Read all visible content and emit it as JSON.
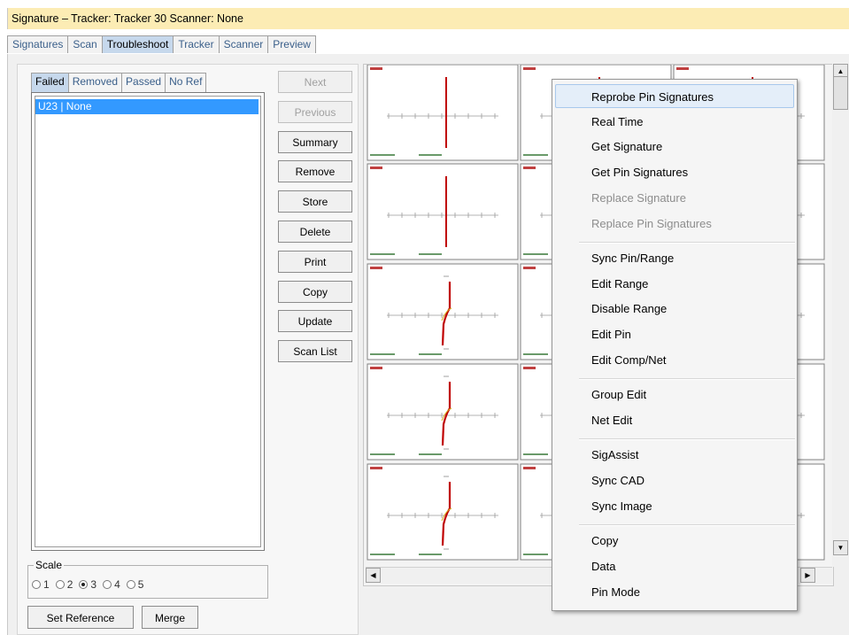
{
  "window": {
    "title": "Signature – Tracker: Tracker 30  Scanner: None"
  },
  "tabs": [
    "Signatures",
    "Scan",
    "Troubleshoot",
    "Tracker",
    "Scanner",
    "Preview"
  ],
  "active_tab": "Troubleshoot",
  "subtabs": [
    "Failed",
    "Removed",
    "Passed",
    "No Ref"
  ],
  "active_subtab": "Failed",
  "list": {
    "items": [
      "U23 | None"
    ],
    "selected": "U23 | None"
  },
  "buttons": {
    "next": "Next",
    "previous": "Previous",
    "summary": "Summary",
    "remove": "Remove",
    "store": "Store",
    "delete": "Delete",
    "print": "Print",
    "copy": "Copy",
    "update": "Update",
    "scan_list": "Scan List",
    "set_reference": "Set Reference",
    "merge": "Merge"
  },
  "scale": {
    "label": "Scale",
    "options": [
      "1",
      "2",
      "3",
      "4",
      "5"
    ],
    "selected": "3"
  },
  "context_menu": {
    "highlighted": "Reprobe Pin Signatures",
    "items": [
      {
        "label": "Reprobe Pin Signatures",
        "enabled": true
      },
      {
        "label": "Real Time",
        "enabled": true
      },
      {
        "label": "Get Signature",
        "enabled": true
      },
      {
        "label": "Get Pin Signatures",
        "enabled": true
      },
      {
        "label": "Replace Signature",
        "enabled": false
      },
      {
        "label": "Replace Pin Signatures",
        "enabled": false
      },
      {
        "label": "Sync Pin/Range",
        "enabled": true
      },
      {
        "label": "Edit Range",
        "enabled": true
      },
      {
        "label": "Disable Range",
        "enabled": true
      },
      {
        "label": "Edit Pin",
        "enabled": true
      },
      {
        "label": "Edit Comp/Net",
        "enabled": true
      },
      {
        "label": "Group Edit",
        "enabled": true
      },
      {
        "label": "Net Edit",
        "enabled": true
      },
      {
        "label": "SigAssist",
        "enabled": true
      },
      {
        "label": "Sync CAD",
        "enabled": true
      },
      {
        "label": "Sync Image",
        "enabled": true
      },
      {
        "label": "Copy",
        "enabled": true
      },
      {
        "label": "Data",
        "enabled": true
      },
      {
        "label": "Pin Mode",
        "enabled": true
      }
    ]
  },
  "colors": {
    "title_bg": "#fcecb4",
    "active_tab_bg": "#c6d8ec",
    "selection": "#3399ff",
    "trace": "#c00000",
    "menu_highlight": "#e4eef9"
  }
}
